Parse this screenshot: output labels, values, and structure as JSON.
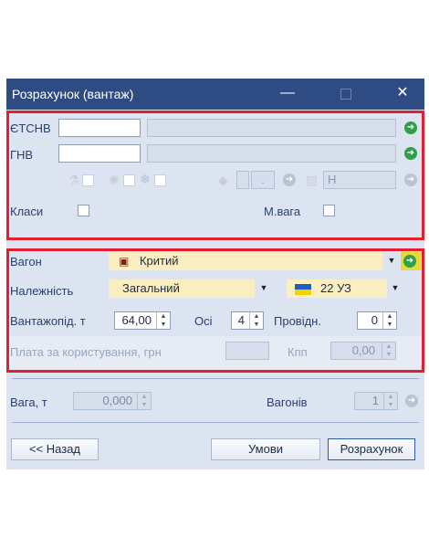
{
  "window": {
    "title": "Розрахунок (вантаж)",
    "controls": {
      "minimize": "—",
      "maximize": "□",
      "close": "✕"
    }
  },
  "codes": {
    "etsnv_label": "ЄТСНВ",
    "gnv_label": "ГНВ",
    "dot_field_value": ".",
    "h_field_value": "Н",
    "classes_label": "Класи",
    "mvaga_label": "М.вага"
  },
  "wagon": {
    "wagon_label": "Вагон",
    "wagon_value": "Критий",
    "belonging_label": "Належність",
    "belonging_value": "Загальний",
    "railway_value": "22 УЗ",
    "capacity_label": "Вантажопід. т",
    "capacity_value": "64,00",
    "axles_label": "Осі",
    "axles_value": "4",
    "conductors_label": "Провідн.",
    "conductors_value": "0",
    "usage_fee_label": "Плата за користування, грн",
    "kpp_label": "Кпп",
    "kpp_value": "0,00"
  },
  "totals": {
    "weight_label": "Вага, т",
    "weight_value": "0,000",
    "wagons_label": "Вагонів",
    "wagons_value": "1"
  },
  "buttons": {
    "back": "<< Назад",
    "conditions": "Умови",
    "calculate": "Розрахунок"
  },
  "colors": {
    "titlebar": "#2e4c83",
    "panel": "#dce4f1",
    "highlight": "#e02030",
    "go": "#2ea04a"
  },
  "icons": [
    "flask-icon",
    "settings-icon",
    "snowflake-icon",
    "diamond-icon",
    "hatch-icon",
    "go-arrow-icon",
    "wagon-icon",
    "ukraine-flag-icon"
  ]
}
